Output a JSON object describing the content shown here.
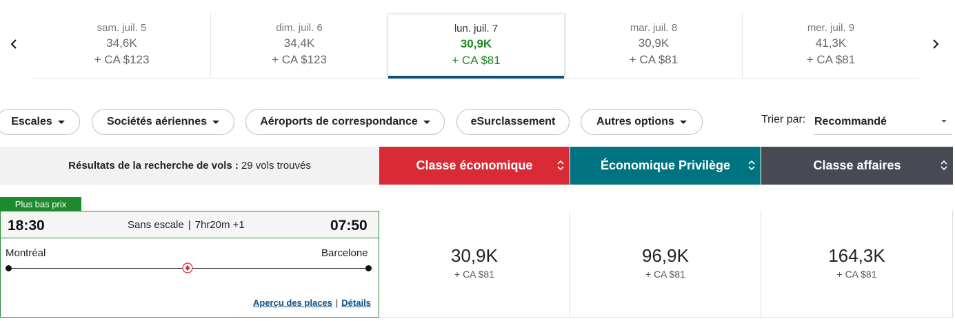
{
  "date_carousel": {
    "dates": [
      {
        "label": "sam. juil. 5",
        "points": "34,6K",
        "cash": "+ CA $123"
      },
      {
        "label": "dim. juil. 6",
        "points": "34,4K",
        "cash": "+ CA $123"
      },
      {
        "label": "lun. juil. 7",
        "points": "30,9K",
        "cash": "+ CA $81",
        "selected": true
      },
      {
        "label": "mar. juil. 8",
        "points": "30,9K",
        "cash": "+ CA $81"
      },
      {
        "label": "mer. juil. 9",
        "points": "41,3K",
        "cash": "+ CA $81"
      }
    ],
    "prev_icon": "chevron-left-icon",
    "next_icon": "chevron-right-icon"
  },
  "filters": {
    "stops": "Escales",
    "airlines": "Sociétés aériennes",
    "connecting_airports": "Aéroports de correspondance",
    "upgrade": "eSurclassement",
    "other_options": "Autres options"
  },
  "sort": {
    "label": "Trier par:",
    "value": "Recommandé"
  },
  "results_header": {
    "title": "Résultats de la recherche de vols :",
    "count": "29 vols trouvés"
  },
  "cabins": {
    "economy": "Classe économique",
    "premium": "Économique Privilège",
    "business": "Classe affaires"
  },
  "colors": {
    "economy": "#d82b35",
    "premium": "#007380",
    "business": "#474a52",
    "selected_price": "#1e8a1e",
    "link": "#0b4f85"
  },
  "flight": {
    "badge": "Plus bas prix",
    "departure_time": "18:30",
    "arrival_time": "07:50",
    "stops": "Sans escale",
    "separator": "|",
    "duration": "7hr20m +1",
    "origin": "Montréal",
    "destination": "Barcelone",
    "seat_preview_link": "Aperçu des places",
    "link_separator": "|",
    "details_link": "Détails",
    "fares": {
      "economy": {
        "points": "30,9K",
        "cash": "+ CA $81"
      },
      "premium": {
        "points": "96,9K",
        "cash": "+ CA $81"
      },
      "business": {
        "points": "164,3K",
        "cash": "+ CA $81"
      }
    }
  }
}
